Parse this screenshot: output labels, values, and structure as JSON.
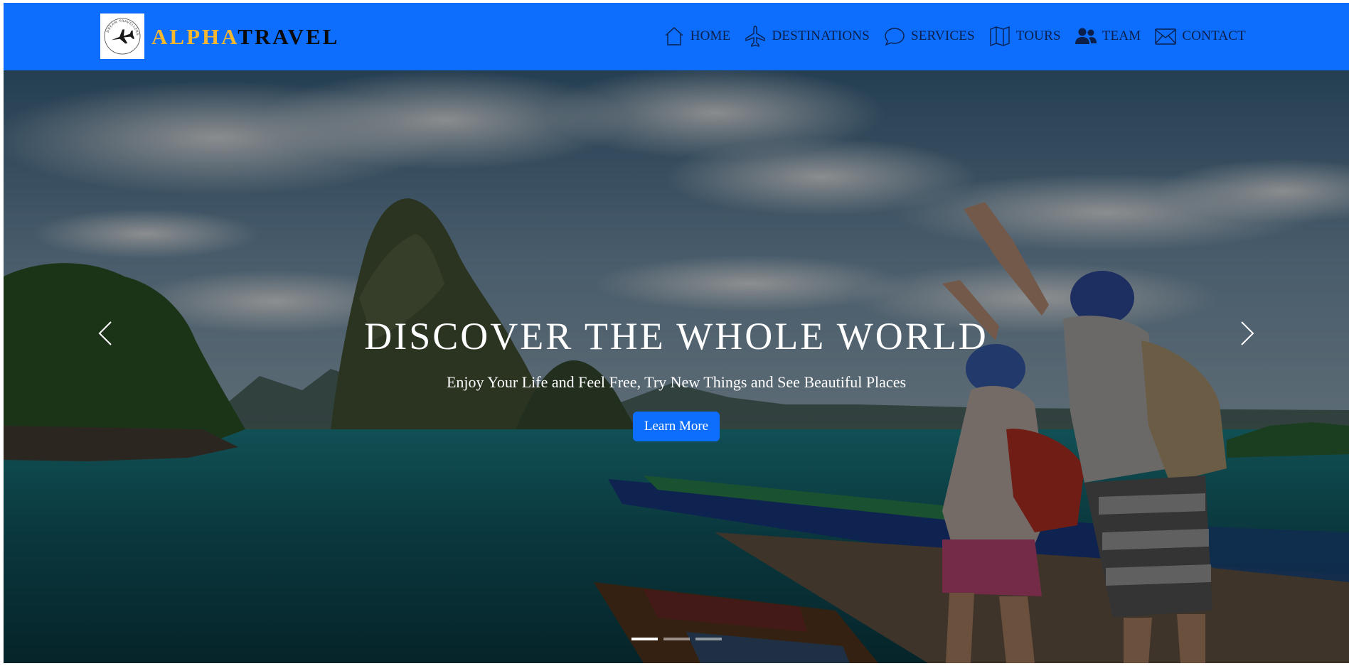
{
  "brand": {
    "part1": "ALPHA",
    "part2": "TRAVEL",
    "logo_text": "DREAM TRAVELLERS",
    "accent_color": "#f5b82e"
  },
  "nav": {
    "background": "#0d6efd",
    "items": [
      {
        "label": "HOME",
        "icon": "house-icon"
      },
      {
        "label": "DESTINATIONS",
        "icon": "airplane-icon"
      },
      {
        "label": "SERVICES",
        "icon": "chat-bubble-icon"
      },
      {
        "label": "TOURS",
        "icon": "map-icon"
      },
      {
        "label": "TEAM",
        "icon": "people-icon"
      },
      {
        "label": "CONTACT",
        "icon": "envelope-icon"
      }
    ]
  },
  "hero": {
    "title": "DISCOVER THE WHOLE WORLD",
    "subtitle": "Enjoy Your Life and Feel Free, Try New Things and See Beautiful Places",
    "button": "Learn More",
    "slides": 3,
    "active_slide": 1,
    "prev_icon": "chevron-left-icon",
    "next_icon": "chevron-right-icon"
  }
}
